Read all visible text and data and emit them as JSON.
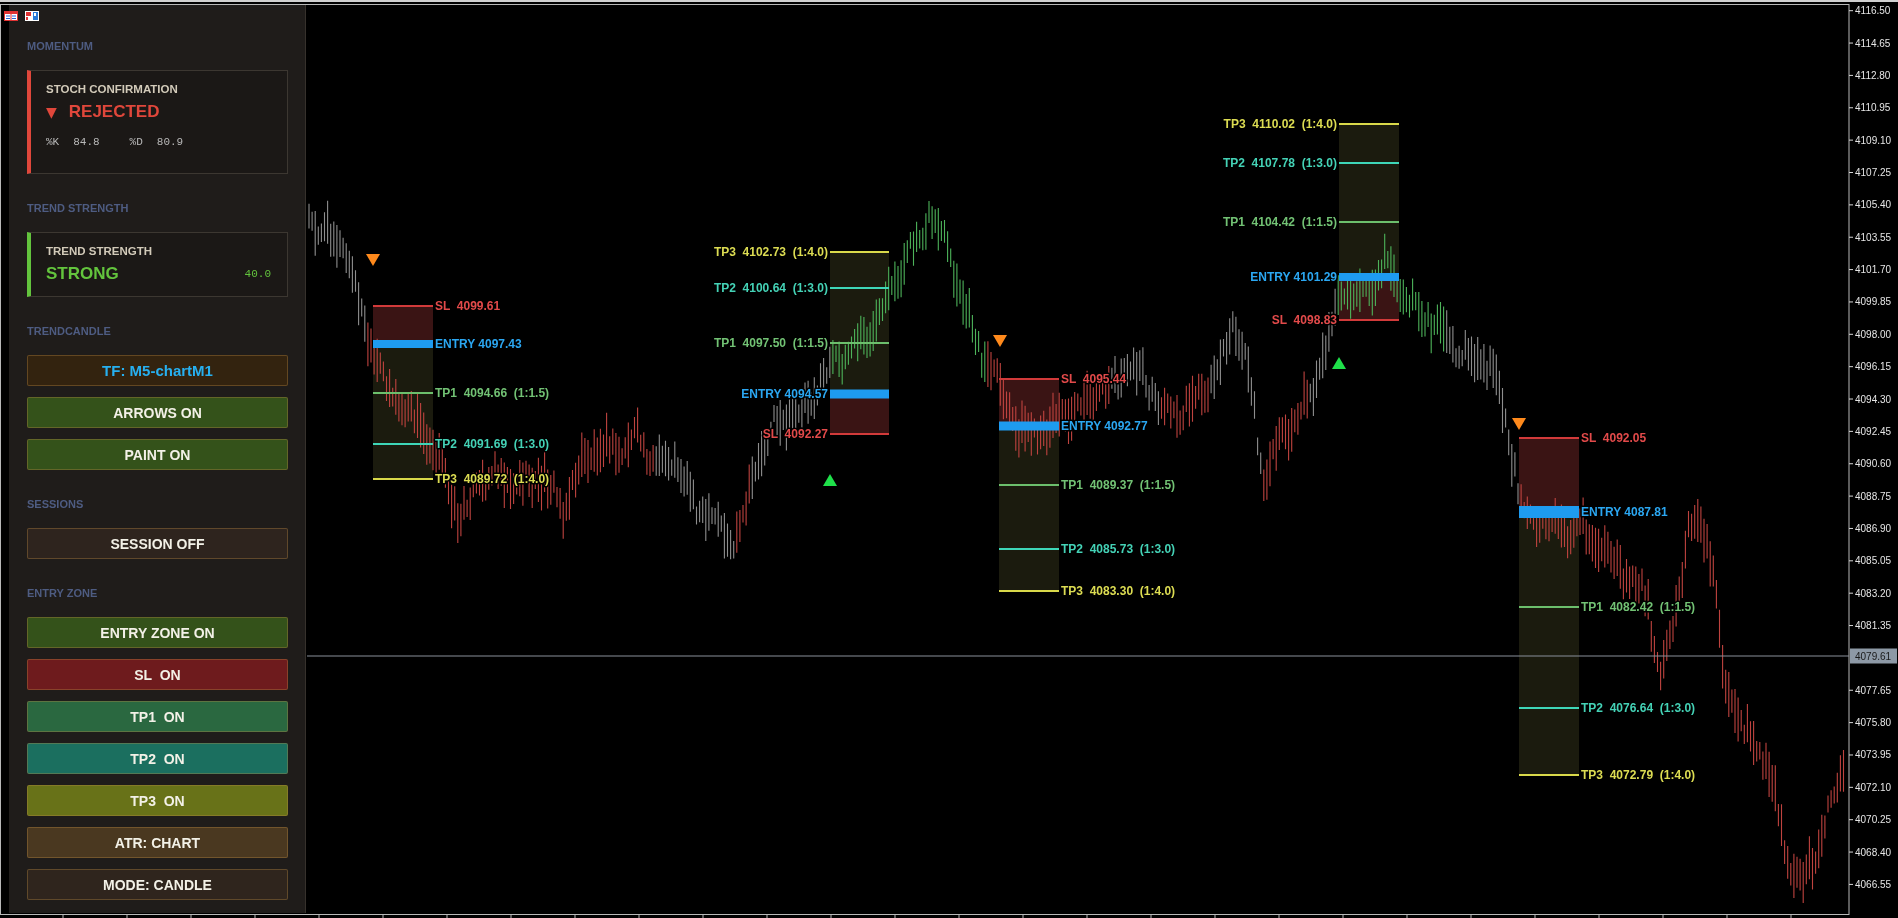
{
  "panel": {
    "sections": [
      {
        "kind": "card",
        "heading": "MOMENTUM",
        "card": {
          "title": "STOCH CONFIRMATION",
          "marker": "▼",
          "status": "REJECTED",
          "color": "#e0473b",
          "readings": [
            {
              "label": "%K",
              "value": "84.8"
            },
            {
              "label": "%D",
              "value": "80.9"
            }
          ]
        }
      },
      {
        "kind": "card",
        "heading": "TREND STRENGTH",
        "card": {
          "title": "TREND STRENGTH",
          "status": "STRONG",
          "score": "40.0",
          "color": "#63c43d"
        }
      },
      {
        "kind": "buttons",
        "heading": "TRENDCANDLE",
        "buttons": [
          {
            "kind": "timeframe",
            "label": "TF: M5-chartM1",
            "color": "#33230f"
          },
          {
            "kind": "toggle",
            "label": "ARROWS ON",
            "color": "#34521a"
          },
          {
            "kind": "toggle",
            "label": "PAINT ON",
            "color": "#34521a"
          }
        ]
      },
      {
        "kind": "buttons",
        "heading": "SESSIONS",
        "buttons": [
          {
            "kind": "toggle",
            "label": "SESSION OFF",
            "color": "#2e241e"
          }
        ]
      },
      {
        "kind": "buttons",
        "heading": "ENTRY ZONE",
        "buttons": [
          {
            "kind": "toggle",
            "label": "ENTRY ZONE ON",
            "color": "#34521a"
          },
          {
            "kind": "toggle",
            "label": "SL  ON",
            "color": "#6e1b1d"
          },
          {
            "kind": "toggle",
            "label": "TP1  ON",
            "color": "#2a6840"
          },
          {
            "kind": "toggle",
            "label": "TP2  ON",
            "color": "#1b6f5f"
          },
          {
            "kind": "toggle",
            "label": "TP3  ON",
            "color": "#687218"
          },
          {
            "kind": "toggle",
            "label": "ATR: CHART",
            "color": "#4a3820"
          },
          {
            "kind": "toggle",
            "label": "MODE: CANDLE",
            "color": "#2f251d"
          }
        ]
      }
    ]
  },
  "chart": {
    "setups": [
      {
        "kind": "sell",
        "levels": [
          {
            "kind": "sl",
            "label": "SL  4099.61"
          },
          {
            "kind": "entry",
            "label": "ENTRY 4097.43"
          },
          {
            "kind": "tp1",
            "label": "TP1  4094.66  (1:1.5)"
          },
          {
            "kind": "tp2",
            "label": "TP2  4091.69  (1:3.0)"
          },
          {
            "kind": "tp3",
            "label": "TP3  4089.72  (1:4.0)"
          }
        ]
      },
      {
        "kind": "buy",
        "levels": [
          {
            "kind": "tp3",
            "label": "TP3  4102.73  (1:4.0)"
          },
          {
            "kind": "tp2",
            "label": "TP2  4100.64  (1:3.0)"
          },
          {
            "kind": "tp1",
            "label": "TP1  4097.50  (1:1.5)"
          },
          {
            "kind": "entry",
            "label": "ENTRY 4094.57"
          },
          {
            "kind": "sl",
            "label": "SL  4092.27"
          }
        ]
      },
      {
        "kind": "sell",
        "levels": [
          {
            "kind": "sl",
            "label": "SL  4095.44"
          },
          {
            "kind": "entry",
            "label": "ENTRY 4092.77"
          },
          {
            "kind": "tp1",
            "label": "TP1  4089.37  (1:1.5)"
          },
          {
            "kind": "tp2",
            "label": "TP2  4085.73  (1:3.0)"
          },
          {
            "kind": "tp3",
            "label": "TP3  4083.30  (1:4.0)"
          }
        ]
      },
      {
        "kind": "buy",
        "levels": [
          {
            "kind": "tp3",
            "label": "TP3  4110.02  (1:4.0)"
          },
          {
            "kind": "tp2",
            "label": "TP2  4107.78  (1:3.0)"
          },
          {
            "kind": "tp1",
            "label": "TP1  4104.42  (1:1.5)"
          },
          {
            "kind": "entry",
            "label": "ENTRY 4101.29"
          },
          {
            "kind": "sl",
            "label": "SL  4098.83"
          }
        ]
      },
      {
        "kind": "sell",
        "levels": [
          {
            "kind": "sl",
            "label": "SL  4092.05"
          },
          {
            "kind": "entry",
            "label": "ENTRY 4087.81"
          },
          {
            "kind": "tp1",
            "label": "TP1  4082.42  (1:1.5)"
          },
          {
            "kind": "tp2",
            "label": "TP2  4076.64  (1:3.0)"
          },
          {
            "kind": "tp3",
            "label": "TP3  4072.79  (1:4.0)"
          }
        ]
      }
    ],
    "price_axis": {
      "ticks": [
        "4116.50",
        "4114.65",
        "4112.80",
        "4110.95",
        "4109.10",
        "4107.25",
        "4105.40",
        "4103.55",
        "4101.70",
        "4099.85",
        "4098.00",
        "4096.15",
        "4094.30",
        "4092.45",
        "4090.60",
        "4088.75",
        "4086.90",
        "4085.05",
        "4083.20",
        "4081.35",
        "4077.65",
        "4075.80",
        "4073.95",
        "4072.10",
        "4070.25",
        "4068.40",
        "4066.55"
      ],
      "current_price": "4079.61"
    }
  }
}
